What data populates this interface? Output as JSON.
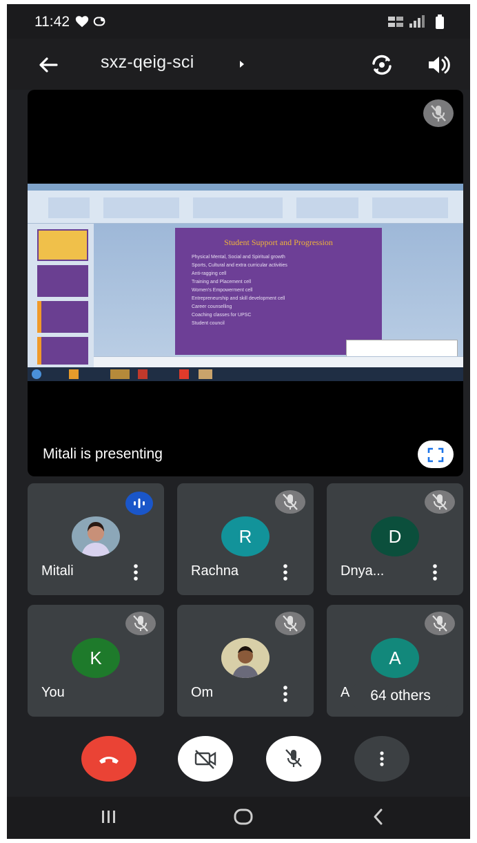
{
  "status_bar": {
    "time": "11:42",
    "icons": [
      "heart-icon",
      "notification-icon",
      "volte-icon",
      "wifi-icon",
      "signal-icon",
      "battery-icon"
    ]
  },
  "app_bar": {
    "meeting_code": "sxz-qeig-sci",
    "icons": [
      "back-arrow-icon",
      "caret-right-icon",
      "switch-camera-icon",
      "speaker-icon"
    ]
  },
  "main_tile": {
    "presenting_label": "Mitali is presenting",
    "shared_slide": {
      "title": "Student Support and Progression",
      "bullets": [
        "Physical Mental, Social and Spiritual growth",
        "Sports, Cultural and extra curricular activities",
        "Anti-ragging cell",
        "Training and Placement cell",
        "Women's Empowerment cell",
        "Entrepreneurship and skill development cell",
        "Career counselling",
        "Coaching classes for UPSC",
        "Student council"
      ]
    },
    "icons": [
      "mic-off-icon",
      "fullscreen-icon"
    ]
  },
  "participants": [
    {
      "name": "Mitali",
      "initial": "",
      "avatar": "photo",
      "color": "#8ca7b8",
      "status": "speaking"
    },
    {
      "name": "Rachna",
      "initial": "R",
      "avatar": "letter",
      "color": "#12939a",
      "status": "muted"
    },
    {
      "name": "Dnya...",
      "initial": "D",
      "avatar": "letter",
      "color": "#0b4f3c",
      "status": "muted"
    },
    {
      "name": "You",
      "initial": "K",
      "avatar": "letter",
      "color": "#1e7a2b",
      "status": "muted"
    },
    {
      "name": "Om",
      "initial": "",
      "avatar": "photo",
      "color": "#a69a7a",
      "status": "muted"
    },
    {
      "name": "A",
      "initial": "A",
      "avatar": "letter",
      "color": "#12887b",
      "status": "muted"
    }
  ],
  "others_pill": "64 others",
  "controls": {
    "buttons": [
      {
        "name": "end-call-button",
        "icon": "phone-hangup-icon",
        "color": "#ea4335"
      },
      {
        "name": "camera-toggle-button",
        "icon": "camera-off-icon",
        "color": "#ffffff"
      },
      {
        "name": "mic-toggle-button",
        "icon": "mic-off-icon",
        "color": "#ffffff"
      },
      {
        "name": "more-options-button",
        "icon": "more-vert-icon",
        "color": "#3c4043"
      }
    ]
  },
  "nav_bar": {
    "icons": [
      "recent-apps-icon",
      "home-icon",
      "back-icon"
    ]
  }
}
